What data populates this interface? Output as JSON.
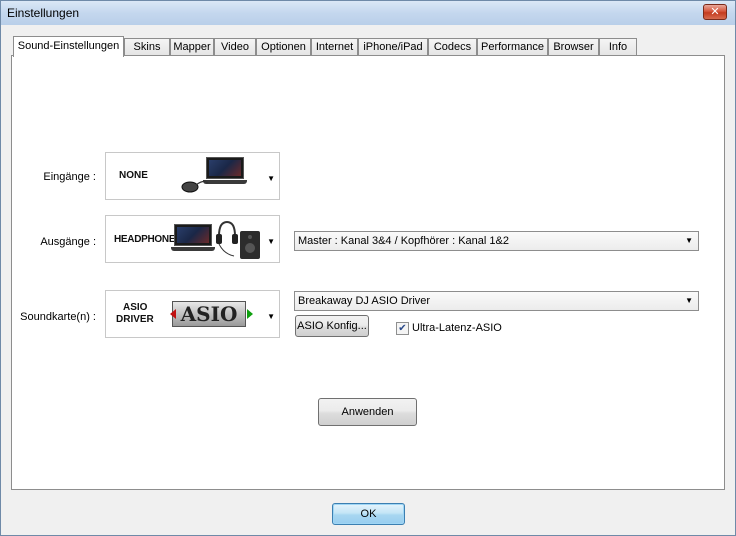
{
  "window": {
    "title": "Einstellungen",
    "close_label": "✕"
  },
  "tabs": [
    {
      "label": "Sound-Einstellungen",
      "active": true
    },
    {
      "label": "Skins"
    },
    {
      "label": "Mapper"
    },
    {
      "label": "Video"
    },
    {
      "label": "Optionen"
    },
    {
      "label": "Internet"
    },
    {
      "label": "iPhone/iPad"
    },
    {
      "label": "Codecs"
    },
    {
      "label": "Performance"
    },
    {
      "label": "Browser"
    },
    {
      "label": "Info"
    }
  ],
  "sound": {
    "inputs": {
      "label": "Eingänge :",
      "device": "NONE"
    },
    "outputs": {
      "label": "Ausgänge :",
      "device": "HEADPHONES",
      "routing": "Master : Kanal 3&4 / Kopfhörer : Kanal 1&2"
    },
    "soundcard": {
      "label": "Soundkarte(n) :",
      "device_line1": "ASIO",
      "device_line2": "DRIVER",
      "logo_text": "ASIO",
      "driver": "Breakaway DJ ASIO Driver",
      "config_button": "ASIO Konfig...",
      "ultra_latency_label": "Ultra-Latenz-ASIO",
      "ultra_latency_checked": true
    },
    "apply_button": "Anwenden"
  },
  "footer": {
    "ok_button": "OK"
  }
}
